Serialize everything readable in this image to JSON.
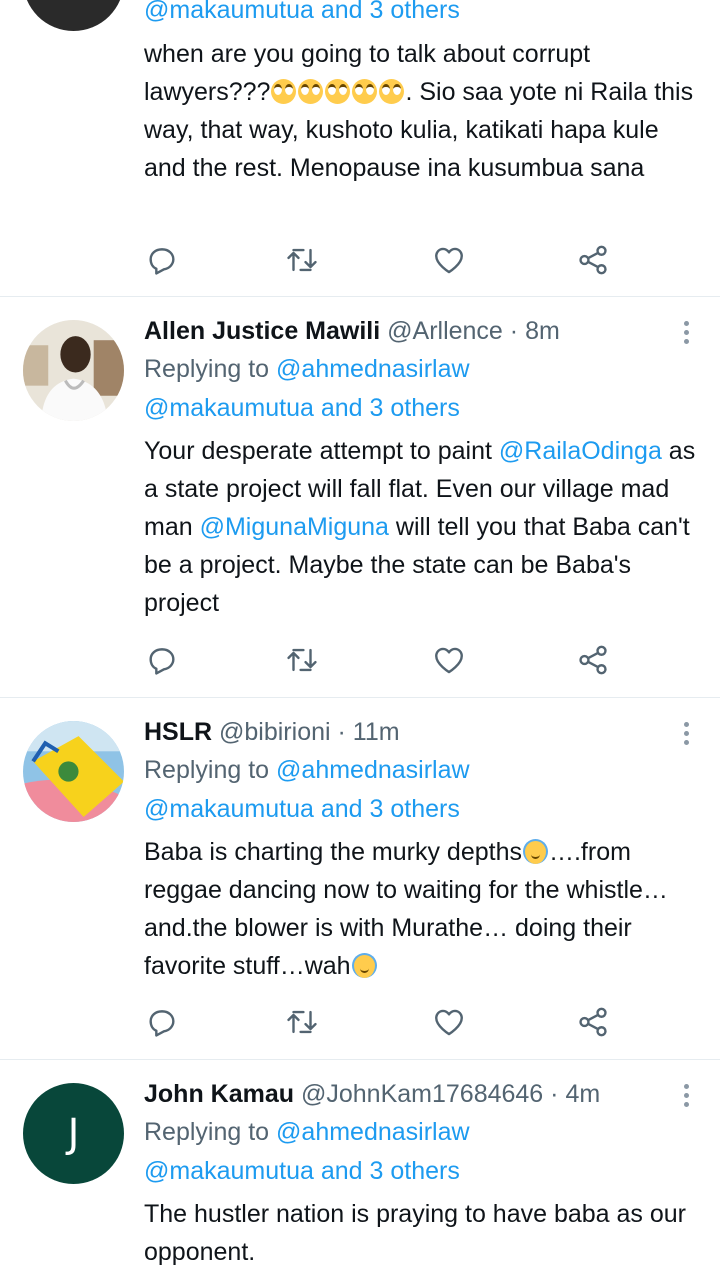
{
  "tweets": [
    {
      "reply_handles": "@makaumutua and 3 others",
      "body": "when are you going to talk about corrupt lawyers???",
      "body_emoji": [
        "face-with-rolling-eyes",
        "face-with-rolling-eyes",
        "face-with-rolling-eyes",
        "face-with-rolling-eyes",
        "face-with-rolling-eyes"
      ],
      "body_tail": ". Sio saa yote ni Raila this way, that way, kushoto kulia, katikati hapa kule and the rest. Menopause ina kusumbua sana"
    },
    {
      "name": "Allen Justice Mawili",
      "handle": "@Arllence",
      "time": "· 8m",
      "replying_label": "Replying to",
      "reply_to": "@ahmednasirlaw",
      "reply_handles": "@makaumutua and 3 others",
      "body_1": "Your desperate attempt to paint",
      "mention_1": "@RailaOdinga",
      "body_2": " as a state project will fall flat. Even our village mad man ",
      "mention_2": "@MigunaMiguna",
      "body_3": " will tell you that Baba can't be a project. Maybe the state can be Baba's project"
    },
    {
      "name": "HSLR",
      "handle": "@bibirioni",
      "time": "· 11m",
      "replying_label": "Replying to",
      "reply_to": "@ahmednasirlaw",
      "reply_handles": "@makaumutua and 3 others",
      "body_1": "Baba is charting the murky depths",
      "body_emoji_1": "smiling-face-with-halo",
      "body_2": "….from reggae dancing now to waiting for the whistle…and.the blower is with Murathe… doing their favorite stuff…wah",
      "body_emoji_2": "smiling-face-with-halo"
    },
    {
      "name": "John Kamau",
      "handle": "@JohnKam17684646",
      "time": "· 4m",
      "avatar_letter": "J",
      "avatar_color": "#08473a",
      "replying_label": "Replying to",
      "reply_to": "@ahmednasirlaw",
      "reply_handles": "@makaumutua and 3 others",
      "body": "The hustler nation is praying to have baba as our opponent."
    }
  ],
  "actions": [
    "reply-icon",
    "retweet-icon",
    "like-icon",
    "share-icon"
  ],
  "colors": {
    "link": "#1d9bf0",
    "secondary": "#536471",
    "divider": "#e6ecf0"
  }
}
